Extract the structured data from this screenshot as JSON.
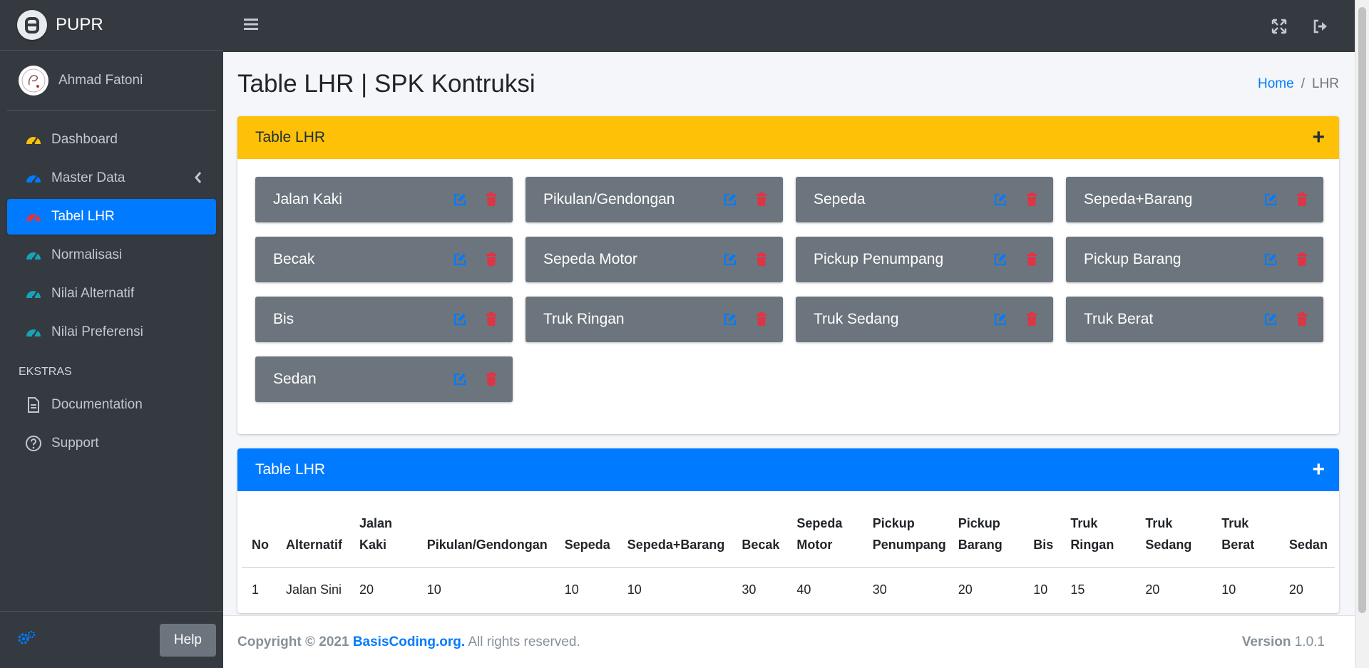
{
  "brand": {
    "name": "PUPR"
  },
  "user": {
    "name": "Ahmad Fatoni"
  },
  "sidebar": {
    "items": [
      {
        "label": "Dashboard",
        "icon": "tachometer-icon",
        "color": "#ffc107"
      },
      {
        "label": "Master Data",
        "icon": "tachometer-icon",
        "color": "#007bff"
      },
      {
        "label": "Tabel LHR",
        "icon": "tachometer-icon",
        "color": "#dc3545"
      },
      {
        "label": "Normalisasi",
        "icon": "tachometer-icon",
        "color": "#17a2b8"
      },
      {
        "label": "Nilai Alternatif",
        "icon": "tachometer-icon",
        "color": "#17a2b8"
      },
      {
        "label": "Nilai Preferensi",
        "icon": "tachometer-icon",
        "color": "#17a2b8"
      }
    ],
    "header": "EKSTRAS",
    "extras": [
      {
        "label": "Documentation",
        "icon": "file-icon"
      },
      {
        "label": "Support",
        "icon": "question-circle-icon"
      }
    ],
    "help_label": "Help"
  },
  "content": {
    "title": "Table LHR | SPK Kontruksi",
    "breadcrumb": {
      "home": "Home",
      "current": "LHR"
    }
  },
  "card1": {
    "title": "Table LHR",
    "tiles": [
      "Jalan Kaki",
      "Pikulan/Gendongan",
      "Sepeda",
      "Sepeda+Barang",
      "Becak",
      "Sepeda Motor",
      "Pickup Penumpang",
      "Pickup Barang",
      "Bis",
      "Truk Ringan",
      "Truk Sedang",
      "Truk Berat",
      "Sedan"
    ]
  },
  "card2": {
    "title": "Table LHR",
    "headers": [
      "No",
      "Alternatif",
      "Jalan Kaki",
      "Pikulan/Gendongan",
      "Sepeda",
      "Sepeda+Barang",
      "Becak",
      "Sepeda Motor",
      "Pickup Penumpang",
      "Pickup Barang",
      "Bis",
      "Truk Ringan",
      "Truk Sedang",
      "Truk Berat",
      "Sedan"
    ],
    "rows": [
      [
        "1",
        "Jalan Sini",
        "20",
        "10",
        "10",
        "10",
        "30",
        "40",
        "30",
        "20",
        "10",
        "15",
        "20",
        "10",
        "20"
      ]
    ]
  },
  "footer": {
    "copyright": "Copyright © 2021",
    "link": "BasisCoding.org.",
    "rights": "All rights reserved.",
    "version_label": "Version",
    "version": "1.0.1"
  },
  "colors": {
    "accent": "#007bff",
    "warning": "#ffc107",
    "danger": "#dc3545",
    "sidebar": "#343a40"
  }
}
